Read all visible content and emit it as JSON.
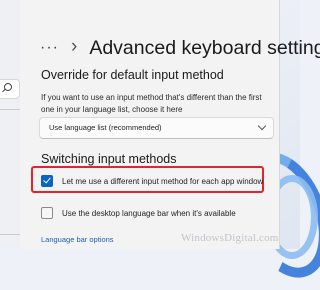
{
  "breadcrumb": {
    "dots": "···",
    "chevron": "›",
    "title": "Advanced keyboard settings"
  },
  "override": {
    "heading": "Override for default input method",
    "description": "If you want to use an input method that's different than the first one in your language list, choose it here",
    "dropdown_value": "Use language list (recommended)"
  },
  "switching": {
    "heading": "Switching input methods",
    "option1": {
      "label": "Let me use a different input method for each app window",
      "checked": true
    },
    "option2": {
      "label": "Use the desktop language bar when it's available",
      "checked": false
    }
  },
  "link": {
    "label": "Language bar options"
  },
  "watermark": "WindowsDigital.com",
  "colors": {
    "accent": "#0a64c4",
    "highlight": "#e4242c",
    "link": "#1a5fb4"
  },
  "icons": {
    "sidebar_search": "search-icon",
    "dropdown": "chevron-down-icon"
  }
}
